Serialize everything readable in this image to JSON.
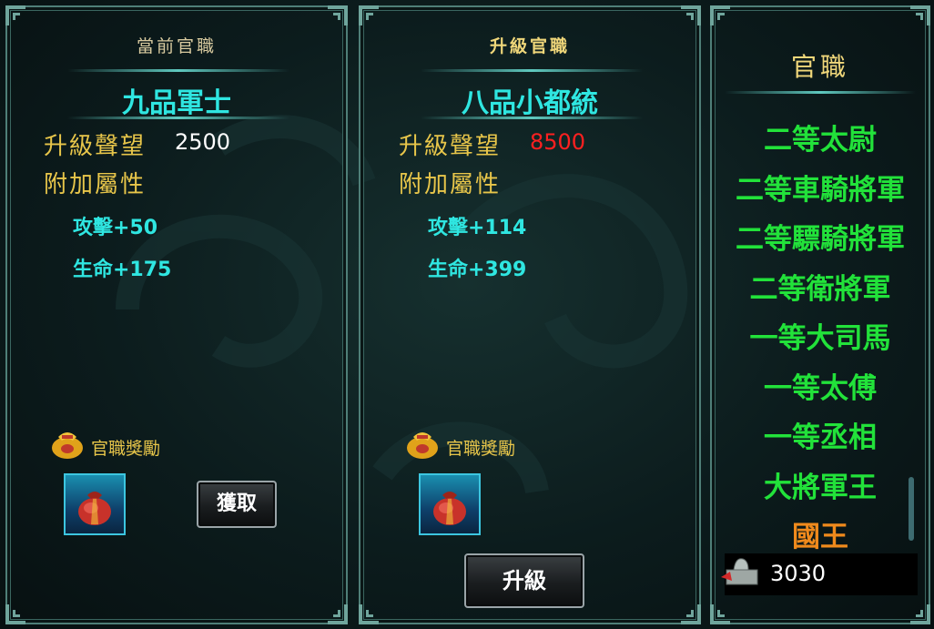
{
  "current_panel": {
    "header": "當前官職",
    "rank_name": "九品軍士",
    "prestige_label": "升級聲望",
    "prestige_value": "2500",
    "attributes_label": "附加屬性",
    "attributes": [
      "攻擊+50",
      "生命+175"
    ],
    "reward_label": "官職獎勵",
    "claim_button": "獲取"
  },
  "upgrade_panel": {
    "header": "升級官職",
    "rank_name": "八品小都統",
    "prestige_label": "升級聲望",
    "prestige_value": "8500",
    "prestige_value_color": "#ff2020",
    "attributes_label": "附加屬性",
    "attributes": [
      "攻擊+114",
      "生命+399"
    ],
    "reward_label": "官職獎勵",
    "upgrade_button": "升級"
  },
  "rank_panel": {
    "header": "官職",
    "ranks": [
      {
        "label": "二等太尉",
        "color": "#22e23a"
      },
      {
        "label": "二等車騎將軍",
        "color": "#22e23a"
      },
      {
        "label": "二等驃騎將軍",
        "color": "#22e23a"
      },
      {
        "label": "二等衛將軍",
        "color": "#22e23a"
      },
      {
        "label": "一等大司馬",
        "color": "#22e23a"
      },
      {
        "label": "一等太傅",
        "color": "#22e23a"
      },
      {
        "label": "一等丞相",
        "color": "#22e23a"
      },
      {
        "label": "大將軍王",
        "color": "#22e23a"
      },
      {
        "label": "國王",
        "color": "#f08a1c"
      }
    ],
    "currency_icon": "jade-seal-icon",
    "currency_value": "3030"
  },
  "colors": {
    "accent_cyan": "#2fe6e1",
    "gold": "#e8c64a",
    "rank_green": "#22e23a",
    "rank_orange": "#f08a1c"
  }
}
